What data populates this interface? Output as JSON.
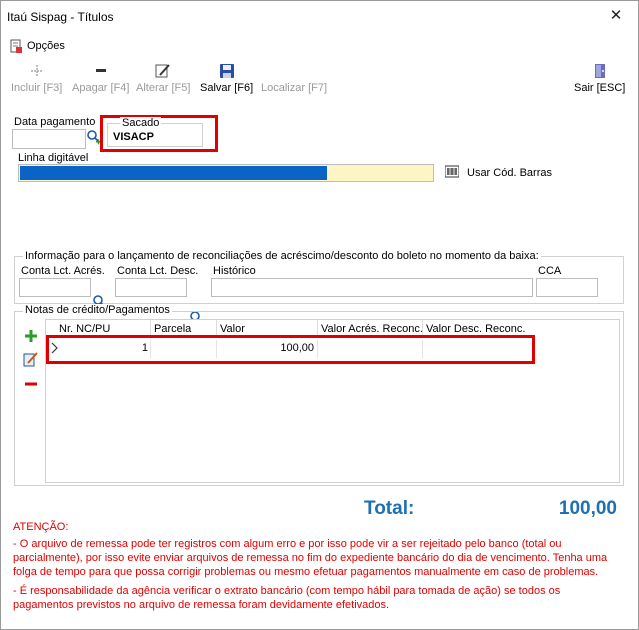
{
  "window": {
    "title": "Itaú Sispag - Títulos",
    "close_glyph": "✕"
  },
  "menu": {
    "options_label": "Opções"
  },
  "toolbar": {
    "buttons": [
      {
        "id": "incluir",
        "label": "Incluir [F3]",
        "icon": "plus-arrow-icon",
        "enabled": false
      },
      {
        "id": "apagar",
        "label": "Apagar [F4]",
        "icon": "minus-icon",
        "enabled": false
      },
      {
        "id": "alterar",
        "label": "Alterar [F5]",
        "icon": "edit-icon",
        "enabled": false
      },
      {
        "id": "salvar",
        "label": "Salvar [F6]",
        "icon": "floppy-disk-icon",
        "enabled": true
      },
      {
        "id": "localizar",
        "label": "Localizar [F7]",
        "icon": "search-icon",
        "enabled": false
      },
      {
        "id": "sair",
        "label": "Sair [ESC]",
        "icon": "exit-door-icon",
        "enabled": true
      }
    ]
  },
  "form": {
    "data_pagamento_label": "Data pagamento",
    "data_pagamento_value": "",
    "sacado_label": "Sacado",
    "sacado_value": "VISACP",
    "linha_digitavel_label": "Linha digitável",
    "usar_cod_barras_label": "Usar Cód. Barras"
  },
  "reconciliation": {
    "title": "Informação para o lançamento de reconciliações de acréscimo/desconto do boleto no momento da baixa:",
    "conta_acres_label": "Conta Lct. Acrés.",
    "conta_desc_label": "Conta Lct. Desc.",
    "historico_label": "Histórico",
    "cca_label": "CCA"
  },
  "notes": {
    "title": "Notas de crédito/Pagamentos",
    "columns": [
      "Nr. NC/PU",
      "Parcela",
      "Valor",
      "Valor Acrés. Reconc.",
      "Valor Desc. Reconc."
    ],
    "rows": [
      {
        "nr": "1",
        "parcela": "",
        "valor": "100,00",
        "acres": "",
        "desc": ""
      }
    ]
  },
  "total": {
    "label": "Total:",
    "value": "100,00"
  },
  "notice": {
    "heading": "ATENÇÃO:",
    "line1": "- O arquivo de remessa pode ter registros com algum erro e por isso pode vir a ser rejeitado pelo banco (total ou",
    "line2": "parcialmente), por isso evite enviar arquivos de remessa no fim do expediente bancário do dia de vencimento. Tenha uma",
    "line3": "folga de tempo para que possa corrigir problemas ou mesmo efetuar pagamentos manualmente em caso de problemas.",
    "line4": "- É responsabilidade da agência verificar o extrato bancário (com tempo hábil para tomada de ação) se todos os",
    "line5": "pagamentos previstos no arquivo de remessa foram devidamente efetivados."
  },
  "colors": {
    "highlight_red": "#e00000",
    "accent_blue": "#1f6fb5",
    "barcode_fill": "#0a64c8",
    "barcode_empty": "#fdf5c4"
  }
}
